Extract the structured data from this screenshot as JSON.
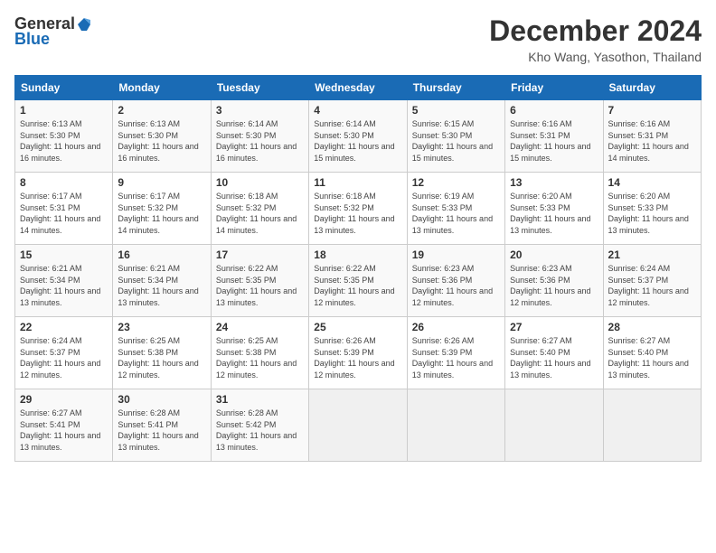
{
  "logo": {
    "general": "General",
    "blue": "Blue"
  },
  "title": {
    "month_year": "December 2024",
    "location": "Kho Wang, Yasothon, Thailand"
  },
  "headers": [
    "Sunday",
    "Monday",
    "Tuesday",
    "Wednesday",
    "Thursday",
    "Friday",
    "Saturday"
  ],
  "weeks": [
    [
      {
        "day": "1",
        "sunrise": "Sunrise: 6:13 AM",
        "sunset": "Sunset: 5:30 PM",
        "daylight": "Daylight: 11 hours and 16 minutes."
      },
      {
        "day": "2",
        "sunrise": "Sunrise: 6:13 AM",
        "sunset": "Sunset: 5:30 PM",
        "daylight": "Daylight: 11 hours and 16 minutes."
      },
      {
        "day": "3",
        "sunrise": "Sunrise: 6:14 AM",
        "sunset": "Sunset: 5:30 PM",
        "daylight": "Daylight: 11 hours and 16 minutes."
      },
      {
        "day": "4",
        "sunrise": "Sunrise: 6:14 AM",
        "sunset": "Sunset: 5:30 PM",
        "daylight": "Daylight: 11 hours and 15 minutes."
      },
      {
        "day": "5",
        "sunrise": "Sunrise: 6:15 AM",
        "sunset": "Sunset: 5:30 PM",
        "daylight": "Daylight: 11 hours and 15 minutes."
      },
      {
        "day": "6",
        "sunrise": "Sunrise: 6:16 AM",
        "sunset": "Sunset: 5:31 PM",
        "daylight": "Daylight: 11 hours and 15 minutes."
      },
      {
        "day": "7",
        "sunrise": "Sunrise: 6:16 AM",
        "sunset": "Sunset: 5:31 PM",
        "daylight": "Daylight: 11 hours and 14 minutes."
      }
    ],
    [
      {
        "day": "8",
        "sunrise": "Sunrise: 6:17 AM",
        "sunset": "Sunset: 5:31 PM",
        "daylight": "Daylight: 11 hours and 14 minutes."
      },
      {
        "day": "9",
        "sunrise": "Sunrise: 6:17 AM",
        "sunset": "Sunset: 5:32 PM",
        "daylight": "Daylight: 11 hours and 14 minutes."
      },
      {
        "day": "10",
        "sunrise": "Sunrise: 6:18 AM",
        "sunset": "Sunset: 5:32 PM",
        "daylight": "Daylight: 11 hours and 14 minutes."
      },
      {
        "day": "11",
        "sunrise": "Sunrise: 6:18 AM",
        "sunset": "Sunset: 5:32 PM",
        "daylight": "Daylight: 11 hours and 13 minutes."
      },
      {
        "day": "12",
        "sunrise": "Sunrise: 6:19 AM",
        "sunset": "Sunset: 5:33 PM",
        "daylight": "Daylight: 11 hours and 13 minutes."
      },
      {
        "day": "13",
        "sunrise": "Sunrise: 6:20 AM",
        "sunset": "Sunset: 5:33 PM",
        "daylight": "Daylight: 11 hours and 13 minutes."
      },
      {
        "day": "14",
        "sunrise": "Sunrise: 6:20 AM",
        "sunset": "Sunset: 5:33 PM",
        "daylight": "Daylight: 11 hours and 13 minutes."
      }
    ],
    [
      {
        "day": "15",
        "sunrise": "Sunrise: 6:21 AM",
        "sunset": "Sunset: 5:34 PM",
        "daylight": "Daylight: 11 hours and 13 minutes."
      },
      {
        "day": "16",
        "sunrise": "Sunrise: 6:21 AM",
        "sunset": "Sunset: 5:34 PM",
        "daylight": "Daylight: 11 hours and 13 minutes."
      },
      {
        "day": "17",
        "sunrise": "Sunrise: 6:22 AM",
        "sunset": "Sunset: 5:35 PM",
        "daylight": "Daylight: 11 hours and 13 minutes."
      },
      {
        "day": "18",
        "sunrise": "Sunrise: 6:22 AM",
        "sunset": "Sunset: 5:35 PM",
        "daylight": "Daylight: 11 hours and 12 minutes."
      },
      {
        "day": "19",
        "sunrise": "Sunrise: 6:23 AM",
        "sunset": "Sunset: 5:36 PM",
        "daylight": "Daylight: 11 hours and 12 minutes."
      },
      {
        "day": "20",
        "sunrise": "Sunrise: 6:23 AM",
        "sunset": "Sunset: 5:36 PM",
        "daylight": "Daylight: 11 hours and 12 minutes."
      },
      {
        "day": "21",
        "sunrise": "Sunrise: 6:24 AM",
        "sunset": "Sunset: 5:37 PM",
        "daylight": "Daylight: 11 hours and 12 minutes."
      }
    ],
    [
      {
        "day": "22",
        "sunrise": "Sunrise: 6:24 AM",
        "sunset": "Sunset: 5:37 PM",
        "daylight": "Daylight: 11 hours and 12 minutes."
      },
      {
        "day": "23",
        "sunrise": "Sunrise: 6:25 AM",
        "sunset": "Sunset: 5:38 PM",
        "daylight": "Daylight: 11 hours and 12 minutes."
      },
      {
        "day": "24",
        "sunrise": "Sunrise: 6:25 AM",
        "sunset": "Sunset: 5:38 PM",
        "daylight": "Daylight: 11 hours and 12 minutes."
      },
      {
        "day": "25",
        "sunrise": "Sunrise: 6:26 AM",
        "sunset": "Sunset: 5:39 PM",
        "daylight": "Daylight: 11 hours and 12 minutes."
      },
      {
        "day": "26",
        "sunrise": "Sunrise: 6:26 AM",
        "sunset": "Sunset: 5:39 PM",
        "daylight": "Daylight: 11 hours and 13 minutes."
      },
      {
        "day": "27",
        "sunrise": "Sunrise: 6:27 AM",
        "sunset": "Sunset: 5:40 PM",
        "daylight": "Daylight: 11 hours and 13 minutes."
      },
      {
        "day": "28",
        "sunrise": "Sunrise: 6:27 AM",
        "sunset": "Sunset: 5:40 PM",
        "daylight": "Daylight: 11 hours and 13 minutes."
      }
    ],
    [
      {
        "day": "29",
        "sunrise": "Sunrise: 6:27 AM",
        "sunset": "Sunset: 5:41 PM",
        "daylight": "Daylight: 11 hours and 13 minutes."
      },
      {
        "day": "30",
        "sunrise": "Sunrise: 6:28 AM",
        "sunset": "Sunset: 5:41 PM",
        "daylight": "Daylight: 11 hours and 13 minutes."
      },
      {
        "day": "31",
        "sunrise": "Sunrise: 6:28 AM",
        "sunset": "Sunset: 5:42 PM",
        "daylight": "Daylight: 11 hours and 13 minutes."
      },
      null,
      null,
      null,
      null
    ]
  ]
}
